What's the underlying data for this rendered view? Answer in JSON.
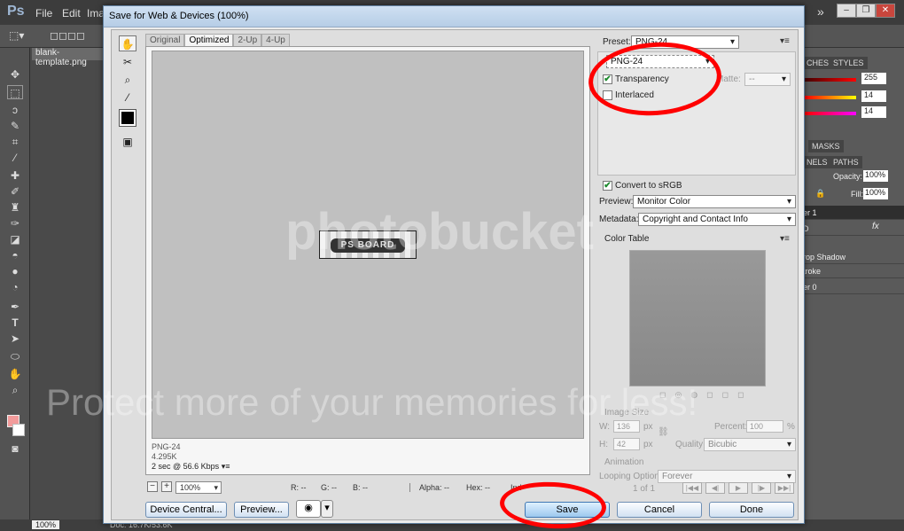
{
  "photoshop": {
    "logo": "Ps",
    "menus": [
      "File",
      "Edit",
      "Ima"
    ],
    "doc_tab": "blank-template.png",
    "zoom": "100%",
    "doc_size": "Doc: 16.7K/53.6K",
    "panels": {
      "swatches_tab": "CHES",
      "styles_tab": "STYLES",
      "rgb": [
        "255",
        "14",
        "14"
      ],
      "masks_tab": "MASKS",
      "channels_tab": "NELS",
      "paths_tab": "PATHS",
      "opacity_label": "Opacity:",
      "opacity_value": "100%",
      "fill_label": "Fill:",
      "fill_value": "100%",
      "layers": [
        "er 1",
        "D",
        "rop Shadow",
        "troke",
        "er 0"
      ]
    }
  },
  "dialog": {
    "title": "Save for Web & Devices (100%)",
    "view_tabs": [
      "Original",
      "Optimized",
      "2-Up",
      "4-Up"
    ],
    "active_tab": "Optimized",
    "thumb_text": "PS BOARD",
    "preview_info": {
      "format": "PNG-24",
      "size": "4.295K",
      "speed": "2 sec @ 56.6 Kbps"
    },
    "zoom": "100%",
    "readouts": {
      "r": "R: --",
      "g": "G: --",
      "b": "B: --",
      "alpha": "Alpha: --",
      "hex": "Hex: --",
      "index": "Ind"
    },
    "buttons": {
      "device_central": "Device Central...",
      "preview": "Preview...",
      "save": "Save",
      "cancel": "Cancel",
      "done": "Done"
    },
    "settings": {
      "preset_label": "Preset:",
      "preset_value": "PNG-24",
      "format_value": "PNG-24",
      "transparency": "Transparency",
      "matte_label": "Matte:",
      "matte_value": "--",
      "interlaced": "Interlaced",
      "convert_srgb": "Convert to sRGB",
      "preview_label": "Preview:",
      "preview_value": "Monitor Color",
      "metadata_label": "Metadata:",
      "metadata_value": "Copyright and Contact Info",
      "color_table_label": "Color Table",
      "image_size_label": "Image Size",
      "w_label": "W:",
      "w_value": "136",
      "h_label": "H:",
      "h_value": "42",
      "px": "px",
      "percent_label": "Percent:",
      "percent_value": "100",
      "percent_unit": "%",
      "quality_label": "Quality:",
      "quality_value": "Bicubic",
      "animation_label": "Animation",
      "looping_label": "Looping Options:",
      "looping_value": "Forever",
      "frame_counter": "1 of 1"
    }
  },
  "watermark": {
    "line1": "photobucket",
    "line2": "Protect more of your memories for less!"
  },
  "colors": {
    "annotation": "#ff0000",
    "primary_button": "#9cc8ee"
  }
}
